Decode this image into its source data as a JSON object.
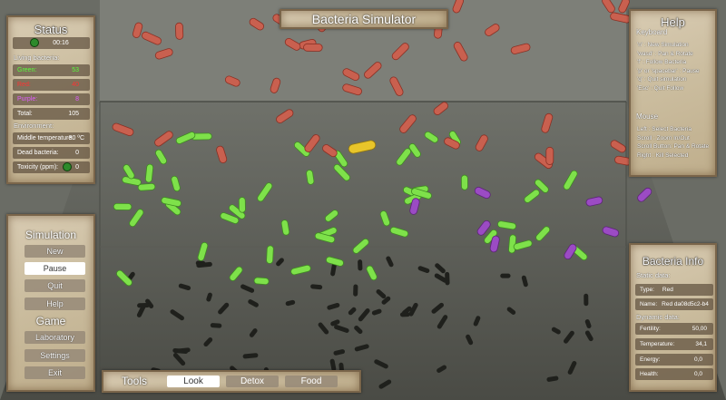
{
  "title": "Bacteria Simulator",
  "status": {
    "title": "Status",
    "timer": "00:16",
    "living_label": "Living bacteria:",
    "green_label": "Green:",
    "green_value": "53",
    "red_label": "Red:",
    "red_value": "40",
    "purple_label": "Purple:",
    "purple_value": "8",
    "total_label": "Total:",
    "total_value": "105",
    "environment_label": "Environment:",
    "temperature_label": "Middle temperature:",
    "temperature_value": "30 ºC",
    "dead_label": "Dead bacteria:",
    "dead_value": "0",
    "toxicity_label": "Toxicity (ppm):",
    "toxicity_value": "0"
  },
  "simulation": {
    "title": "Simulation",
    "buttons": [
      "New",
      "Pause",
      "Quit",
      "Help"
    ],
    "selected": "Pause",
    "game_title": "Game",
    "game_buttons": [
      "Laboratory",
      "Settings",
      "Exit"
    ]
  },
  "tools": {
    "label": "Tools",
    "buttons": [
      "Look",
      "Detox",
      "Food"
    ],
    "selected": "Look"
  },
  "help": {
    "title": "Help",
    "keyboard_label": "Keyboard",
    "keyboard_lines": "'n' : New Simulation\n'wasd' : Pan & Rotate\n'f' : Follow Bacteria\n'p' or 'spacebar' : Pause\n'q' : Quit simulation\n'Esc' : Quit Follow",
    "mouse_label": "Mouse",
    "mouse_lines": "Left : Select Bacteria\nScroll : Zoom In/Out\nScroll Button: Pan & Rotate\nRight : Kill Selected"
  },
  "info": {
    "title": "Bacteria Info",
    "static_label": "Static data:",
    "type_label": "Type:",
    "type_value": "Red",
    "name_label": "Name:",
    "name_value": "Red da08d5c2-b4",
    "dynamic_label": "Dynamic data:",
    "fertility_label": "Fertility:",
    "fertility_value": "50,00",
    "temperature_label": "Temperature:",
    "temperature_value": "34,1",
    "energy_label": "Energy:",
    "energy_value": "0,0",
    "health_label": "Health:",
    "health_value": "0,0"
  },
  "colors": {
    "green": "#7ee14a",
    "red": "#ff3b3b",
    "purple": "#d45cf0",
    "yellow": "#e8c52a"
  }
}
